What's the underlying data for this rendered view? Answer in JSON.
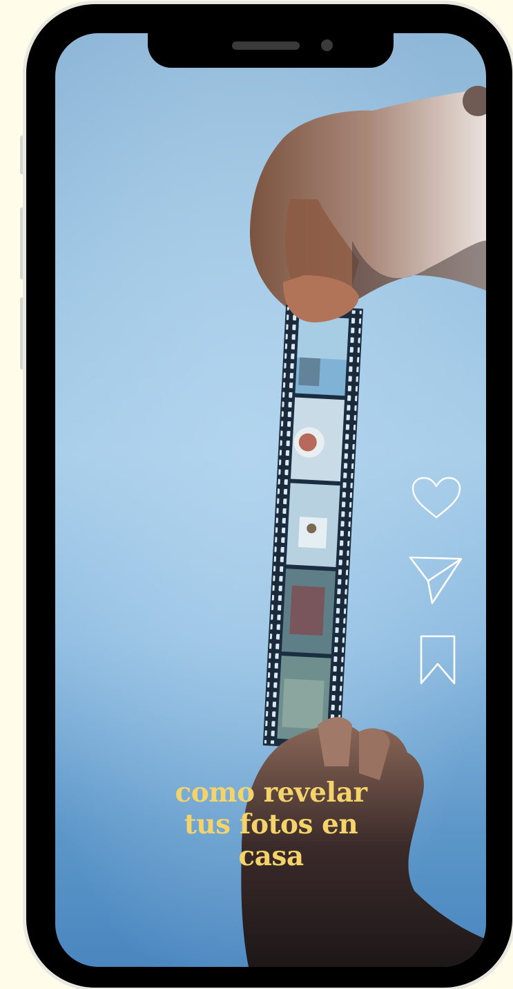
{
  "post": {
    "caption_lines": [
      "como revelar",
      "tus fotos en",
      "casa"
    ]
  },
  "actions": {
    "like_icon": "heart-icon",
    "share_icon": "paper-plane-icon",
    "save_icon": "bookmark-icon"
  },
  "colors": {
    "page_background": "#fffde9",
    "caption": "#f4d46a",
    "phone_frame": "#000000",
    "icon_stroke": "#ffffff"
  }
}
